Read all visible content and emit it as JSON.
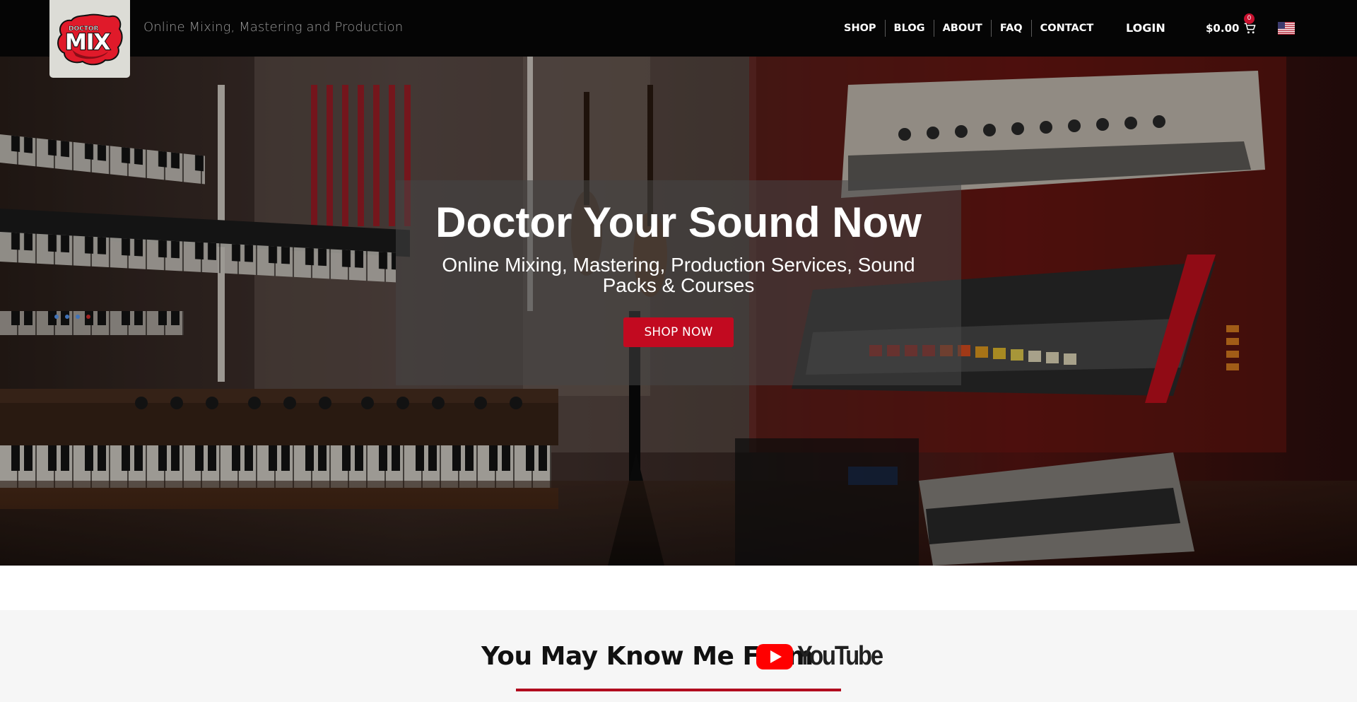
{
  "header": {
    "logo_small_text": "DOCTOR",
    "logo_big_text": "MIX",
    "tagline": "Online Mixing, Mastering and Production",
    "nav": [
      "SHOP",
      "BLOG",
      "ABOUT",
      "FAQ",
      "CONTACT"
    ],
    "login_label": "LOGIN",
    "cart_total": "$0.00",
    "cart_count": "0",
    "cart_icon": "shopping-cart-icon",
    "flag_icon": "us-flag-icon"
  },
  "hero": {
    "title": "Doctor Your Sound Now",
    "subtitle": "Online Mixing, Mastering, Production Services, Sound Packs & Courses",
    "button_label": "SHOP NOW"
  },
  "youtube_section": {
    "heading": "You May Know Me From",
    "logo_text": "YouTube",
    "logo_icon": "youtube-play-icon"
  },
  "colors": {
    "header_bg": "#050505",
    "accent_red": "#c20a20",
    "section_bg": "#f6f6f6"
  }
}
